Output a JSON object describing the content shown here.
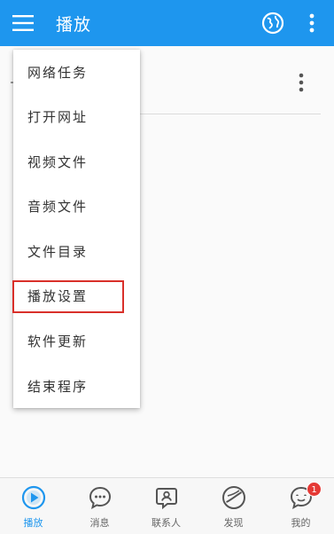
{
  "header": {
    "title": "播放",
    "menu_icon": "hamburger-menu-icon",
    "globe_icon": "globe-icon",
    "more_icon": "more-vertical-icon"
  },
  "dropdown": {
    "items": [
      {
        "label": "网络任务"
      },
      {
        "label": "打开网址"
      },
      {
        "label": "视频文件"
      },
      {
        "label": "音频文件"
      },
      {
        "label": "文件目录"
      },
      {
        "label": "播放设置",
        "highlighted": true
      },
      {
        "label": "软件更新"
      },
      {
        "label": "结束程序"
      }
    ]
  },
  "bottom_nav": {
    "items": [
      {
        "label": "播放",
        "icon": "play-icon",
        "active": true
      },
      {
        "label": "消息",
        "icon": "message-icon"
      },
      {
        "label": "联系人",
        "icon": "contacts-icon"
      },
      {
        "label": "发现",
        "icon": "discover-icon"
      },
      {
        "label": "我的",
        "icon": "profile-icon",
        "badge": "1"
      }
    ]
  },
  "colors": {
    "primary": "#1e96ee",
    "highlight_border": "#d9302a",
    "badge": "#e53935"
  }
}
